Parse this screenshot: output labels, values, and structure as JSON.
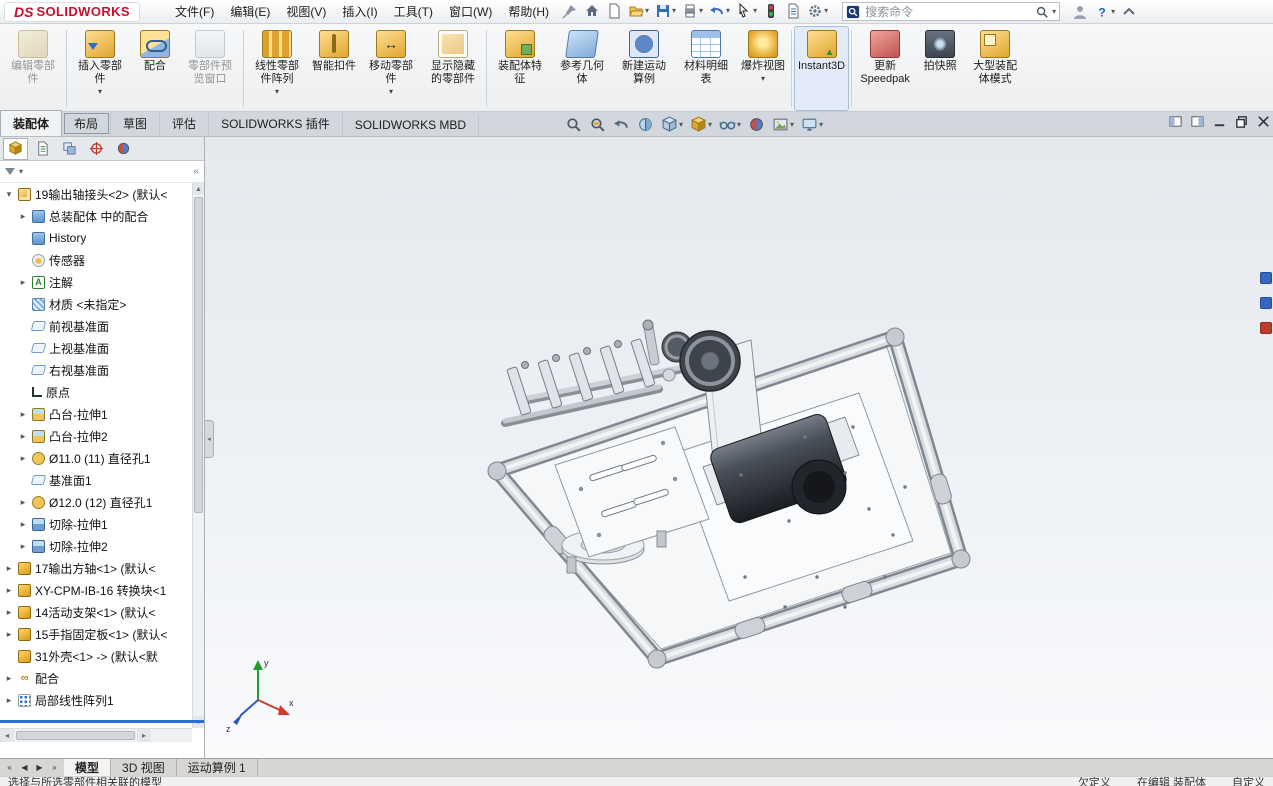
{
  "titlebar": {
    "brand": {
      "prefix": "DS",
      "name": "SOLIDWORKS"
    },
    "menus": [
      "文件(F)",
      "编辑(E)",
      "视图(V)",
      "插入(I)",
      "工具(T)",
      "窗口(W)",
      "帮助(H)"
    ],
    "quick_icons": [
      {
        "name": "home-icon"
      },
      {
        "name": "new-file-icon"
      },
      {
        "name": "open-file-icon",
        "dropdown": true
      },
      {
        "name": "save-icon",
        "dropdown": true
      },
      {
        "name": "print-icon",
        "dropdown": true
      },
      {
        "name": "undo-icon",
        "dropdown": true
      },
      {
        "name": "select-icon",
        "dropdown": true
      },
      {
        "name": "rebuild-icon"
      },
      {
        "name": "file-properties-icon"
      },
      {
        "name": "options-icon",
        "dropdown": true
      }
    ],
    "search": {
      "placeholder": "搜索命令"
    },
    "right_icons": [
      {
        "name": "user-icon"
      },
      {
        "name": "help-icon",
        "dropdown": true
      },
      {
        "name": "chevron-up-icon"
      }
    ]
  },
  "ribbon": {
    "buttons": [
      {
        "name": "edit-component",
        "label": "编辑零部件",
        "icon": "edit",
        "disabled": true
      },
      {
        "name": "insert-components",
        "label": "插入零部件",
        "icon": "insert",
        "dropdown": true
      },
      {
        "name": "mate",
        "label": "配合",
        "icon": "mate"
      },
      {
        "name": "component-preview-window",
        "label": "零部件预览窗口",
        "icon": "preview",
        "disabled": true
      },
      {
        "name": "linear-component-pattern",
        "label": "线性零部件阵列",
        "icon": "pattern",
        "dropdown": true
      },
      {
        "name": "smart-fasteners",
        "label": "智能扣件",
        "icon": "fastener"
      },
      {
        "name": "move-component",
        "label": "移动零部件",
        "icon": "move",
        "dropdown": true
      },
      {
        "name": "show-hidden-components",
        "label": "显示隐藏的零部件",
        "icon": "ghost"
      },
      {
        "name": "assembly-features",
        "label": "装配体特征",
        "icon": "feature"
      },
      {
        "name": "reference-geometry",
        "label": "参考几何体",
        "icon": "refgeo"
      },
      {
        "name": "new-motion-study",
        "label": "新建运动算例",
        "icon": "motion"
      },
      {
        "name": "bill-of-materials",
        "label": "材料明细表",
        "icon": "bom"
      },
      {
        "name": "exploded-view",
        "label": "爆炸视图",
        "icon": "explode",
        "dropdown": true
      },
      {
        "name": "instant3d",
        "label": "Instant3D",
        "icon": "instant3d",
        "active": true
      },
      {
        "name": "update-speedpak",
        "label": "更新 Speedpak",
        "icon": "speedpak"
      },
      {
        "name": "take-snapshot",
        "label": "拍快照",
        "icon": "snapshot"
      },
      {
        "name": "large-assembly-mode",
        "label": "大型装配体模式",
        "icon": "large"
      }
    ]
  },
  "tabstrip": {
    "tabs": [
      {
        "label": "装配体",
        "active": true
      },
      {
        "label": "布局",
        "focused": true
      },
      {
        "label": "草图"
      },
      {
        "label": "评估"
      },
      {
        "label": "SOLIDWORKS 插件"
      },
      {
        "label": "SOLIDWORKS MBD"
      }
    ]
  },
  "view_toolbar": {
    "icons": [
      {
        "name": "zoom-fit-icon"
      },
      {
        "name": "zoom-area-icon"
      },
      {
        "name": "previous-view-icon"
      },
      {
        "name": "section-view-icon"
      },
      {
        "name": "view-orientation-icon",
        "dropdown": true
      },
      {
        "name": "display-style-icon",
        "dropdown": true
      },
      {
        "name": "hide-show-items-icon",
        "dropdown": true
      },
      {
        "name": "edit-appearance-icon"
      },
      {
        "name": "apply-scene-icon",
        "dropdown": true
      },
      {
        "name": "view-settings-icon",
        "dropdown": true
      }
    ]
  },
  "window_controls": [
    {
      "name": "pane-left-icon"
    },
    {
      "name": "pane-right-icon"
    },
    {
      "name": "minimize-icon"
    },
    {
      "name": "restore-icon"
    },
    {
      "name": "close-icon"
    }
  ],
  "panel": {
    "tabs": [
      {
        "name": "featuremanager-tab",
        "active": true
      },
      {
        "name": "propertymanager-tab"
      },
      {
        "name": "configurationmanager-tab"
      },
      {
        "name": "dimxpertmanager-tab"
      },
      {
        "name": "displaymanager-tab"
      }
    ],
    "tree": {
      "items": [
        {
          "label": "19输出轴接头<2> (默认<",
          "icon": "assembly",
          "indent": 0,
          "expand": "open"
        },
        {
          "label": "总装配体 中的配合",
          "icon": "mates-folder",
          "indent": 1,
          "expand": "closed"
        },
        {
          "label": "History",
          "icon": "history-folder",
          "indent": 1,
          "expand": null
        },
        {
          "label": "传感器",
          "icon": "sensors",
          "indent": 1,
          "expand": null
        },
        {
          "label": "注解",
          "icon": "annotations",
          "char": "A",
          "indent": 1,
          "expand": "closed"
        },
        {
          "label": "材质 <未指定>",
          "icon": "material",
          "indent": 1,
          "expand": null
        },
        {
          "label": "前视基准面",
          "icon": "plane",
          "indent": 1,
          "expand": null
        },
        {
          "label": "上视基准面",
          "icon": "plane",
          "indent": 1,
          "expand": null
        },
        {
          "label": "右视基准面",
          "icon": "plane",
          "indent": 1,
          "expand": null
        },
        {
          "label": "原点",
          "icon": "origin",
          "indent": 1,
          "expand": null
        },
        {
          "label": "凸台-拉伸1",
          "icon": "boss",
          "indent": 1,
          "expand": "closed"
        },
        {
          "label": "凸台-拉伸2",
          "icon": "boss",
          "indent": 1,
          "expand": "closed"
        },
        {
          "label": "Ø11.0 (11) 直径孔1",
          "icon": "hole",
          "indent": 1,
          "expand": "closed"
        },
        {
          "label": "基准面1",
          "icon": "plane",
          "indent": 1,
          "expand": null
        },
        {
          "label": "Ø12.0 (12) 直径孔1",
          "icon": "hole",
          "indent": 1,
          "expand": "closed"
        },
        {
          "label": "切除-拉伸1",
          "icon": "cut",
          "indent": 1,
          "expand": "closed"
        },
        {
          "label": "切除-拉伸2",
          "icon": "cut",
          "indent": 1,
          "expand": "closed"
        },
        {
          "label": "17输出方轴<1> (默认<",
          "icon": "part",
          "indent": 0,
          "expand": "closed"
        },
        {
          "label": "XY-CPM-IB-16 转换块<1",
          "icon": "part",
          "indent": 0,
          "expand": "closed"
        },
        {
          "label": "14活动支架<1> (默认<",
          "icon": "part",
          "indent": 0,
          "expand": "closed"
        },
        {
          "label": "15手指固定板<1> (默认<",
          "icon": "part",
          "indent": 0,
          "expand": "closed"
        },
        {
          "label": "31外壳<1> -> (默认<默",
          "icon": "part",
          "indent": 0,
          "expand": null
        },
        {
          "label": "配合",
          "icon": "mates",
          "char": "∞",
          "indent": 0,
          "expand": "closed"
        },
        {
          "label": "局部线性阵列1",
          "icon": "pattern",
          "indent": 0,
          "expand": "closed"
        }
      ]
    }
  },
  "viewport": {
    "triad": {
      "x": "x",
      "y": "y",
      "z": "z"
    }
  },
  "task_pane": [
    {
      "name": "task-pane-tab-1",
      "color": "#3566c4"
    },
    {
      "name": "task-pane-tab-2",
      "color": "#3566c4"
    },
    {
      "name": "task-pane-tab-3",
      "color": "#c0392b"
    }
  ],
  "bottom_tabs": {
    "nav": [
      "«",
      "◀",
      "▶",
      "»"
    ],
    "tabs": [
      {
        "label": "模型",
        "active": true
      },
      {
        "label": "3D 视图"
      },
      {
        "label": "运动算例 1"
      }
    ]
  },
  "statusbar": {
    "left": "选择与所选零部件相关联的模型",
    "items": [
      "欠定义",
      "在编辑 装配体",
      "自定义"
    ]
  },
  "colors": {
    "logo_red": "#c8102e",
    "gold": "#e8b13c",
    "selection_blue": "#2a6fd6"
  }
}
